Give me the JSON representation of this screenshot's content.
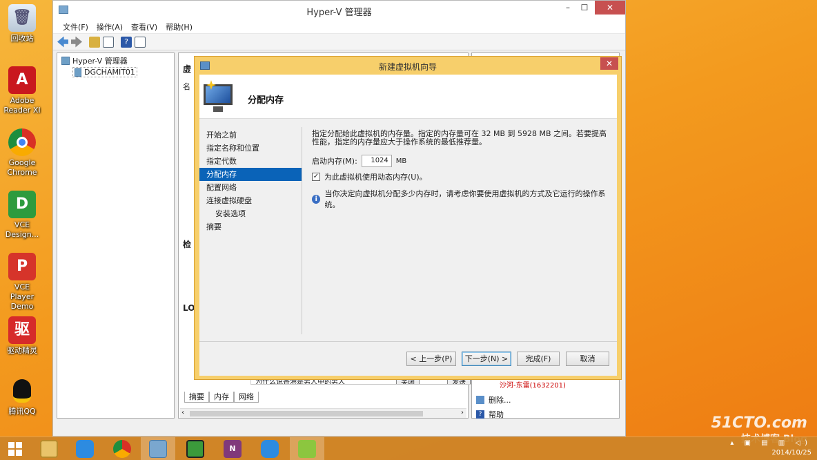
{
  "desktop": {
    "icons": [
      {
        "label": "回收站"
      },
      {
        "label": "Adobe Reader XI"
      },
      {
        "label": "Google Chrome"
      },
      {
        "label": "VCE Design..."
      },
      {
        "label": "VCE Player Demo"
      },
      {
        "label": "驱动精灵"
      },
      {
        "label": "腾讯QQ"
      }
    ],
    "watermark": {
      "line1": "51CTO.com",
      "line2": "技术博客 Blog"
    }
  },
  "taskbar": {
    "date": "2014/10/25"
  },
  "mmc": {
    "title": "Hyper-V 管理器",
    "menu": [
      "文件(F)",
      "操作(A)",
      "查看(V)",
      "帮助(H)"
    ],
    "tree": {
      "root": "Hyper-V 管理器",
      "server": "DGCHAMIT01"
    },
    "center": {
      "header": "虚",
      "col": "名",
      "checkpoints": "检",
      "logs": "LO",
      "marquee": "为什么说香港是男人中的男人",
      "btn1": "关闭",
      "btn2": "发送",
      "user": "沙河-东雷(1632201)"
    },
    "tabs": [
      "摘要",
      "内存",
      "网络"
    ],
    "actions": {
      "header": "操",
      "items": [
        "删除...",
        "帮助"
      ]
    }
  },
  "wizard": {
    "title": "新建虚拟机向导",
    "close": "✕",
    "heading": "分配内存",
    "steps": [
      {
        "label": "开始之前",
        "sub": false,
        "selected": false
      },
      {
        "label": "指定名称和位置",
        "sub": false,
        "selected": false
      },
      {
        "label": "指定代数",
        "sub": false,
        "selected": false
      },
      {
        "label": "分配内存",
        "sub": false,
        "selected": true
      },
      {
        "label": "配置网络",
        "sub": false,
        "selected": false
      },
      {
        "label": "连接虚拟硬盘",
        "sub": false,
        "selected": false
      },
      {
        "label": "安装选项",
        "sub": true,
        "selected": false
      },
      {
        "label": "摘要",
        "sub": false,
        "selected": false
      }
    ],
    "description": "指定分配给此虚拟机的内存量。指定的内存量可在 32 MB 到 5928 MB 之间。若要提高性能，指定的内存量应大于操作系统的最低推荐量。",
    "startup_label": "启动内存(M):",
    "startup_value": "1024",
    "unit": "MB",
    "dynamic_label": "为此虚拟机使用动态内存(U)。",
    "dynamic_checked": true,
    "info_text": "当你决定向虚拟机分配多少内存时，请考虑你要使用虚拟机的方式及它运行的操作系统。",
    "buttons": {
      "prev": "< 上一步(P)",
      "next": "下一步(N) >",
      "finish": "完成(F)",
      "cancel": "取消"
    }
  }
}
